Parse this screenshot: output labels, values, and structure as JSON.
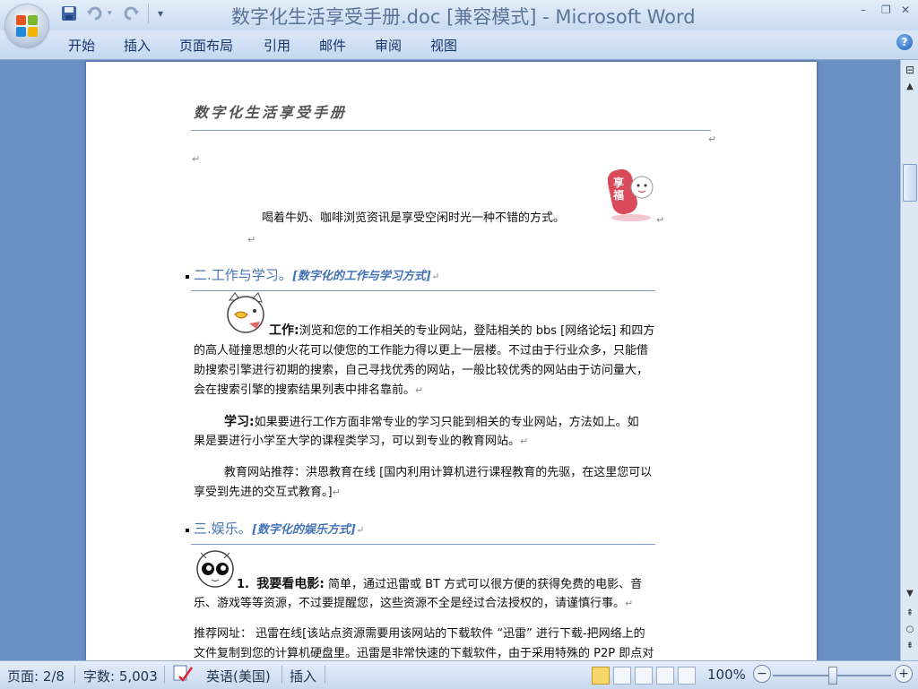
{
  "window": {
    "title": "数字化生活享受手册.doc [兼容模式] - Microsoft Word",
    "controls": {
      "minimize": "–",
      "restore": "❐",
      "close": "✕"
    }
  },
  "quick_access": {
    "save_icon": "save-icon",
    "undo_icon": "undo-icon",
    "redo_icon": "redo-icon",
    "customize_icon": "customize-qat-icon"
  },
  "ribbon": {
    "tabs": [
      "开始",
      "插入",
      "页面布局",
      "引用",
      "邮件",
      "审阅",
      "视图"
    ],
    "help": "?"
  },
  "document": {
    "header_title": "数字化生活享受手册",
    "para_mark": "↵",
    "intro": "喝着牛奶、咖啡浏览资讯是享受空闲时光一种不错的方式。",
    "sticker_text": "享福",
    "section2": {
      "title": "二.工作与学习。",
      "sub": "[数字化的工作与学习方式]"
    },
    "work": {
      "label": "工作:",
      "lines": [
        "浏览和您的工作相关的专业网站，登陆相关的 bbs [网络论坛] 和四方",
        "的高人碰撞思想的火花可以使您的工作能力得以更上一层楼。不过由于行业众多，只能借",
        "助搜索引擎进行初期的搜索，自己寻找优秀的网站，一般比较优秀的网站由于访问量大，",
        "会在搜索引擎的搜索结果列表中排名靠前。"
      ]
    },
    "study": {
      "label": "学习:",
      "lines": [
        "如果要进行工作方面非常专业的学习只能到相关的专业网站，方法如上。如",
        "果是要进行小学至大学的课程类学习，可以到专业的教育网站。"
      ]
    },
    "edu": {
      "lines": [
        "教育网站推荐：洪恩教育在线 [国内利用计算机进行课程教育的先驱，在这里您可以",
        "享受到先进的交互式教育。]"
      ]
    },
    "section3": {
      "title": "三.娱乐。",
      "sub": "[数字化的娱乐方式]"
    },
    "movie": {
      "num": "1.",
      "label": "我要看电影:",
      "lines": [
        "简单，通过迅雷或 BT 方式可以很方便的获得免费的电影、音",
        "乐、游戏等等资源，不过要提醒您，这些资源不全是经过合法授权的，请谨慎行事。"
      ]
    },
    "recommend": {
      "lines": [
        "推荐网址：  迅雷在线[该站点资源需要用该网站的下载软件 “迅雷” 进行下载-把网络上的",
        "文件复制到您的计算机硬盘里。迅雷是非常快速的下载软件，由于采用特殊的 P2P 即点对"
      ]
    }
  },
  "statusbar": {
    "page": "页面: 2/8",
    "words": "字数: 5,003",
    "language": "英语(美国)",
    "mode": "插入",
    "zoom": "100%",
    "zoom_minus": "−",
    "zoom_plus": "+"
  },
  "colors": {
    "accent": "#4473b5",
    "titlebar": "#c9dbf1",
    "workspace": "#6a8fc2"
  }
}
